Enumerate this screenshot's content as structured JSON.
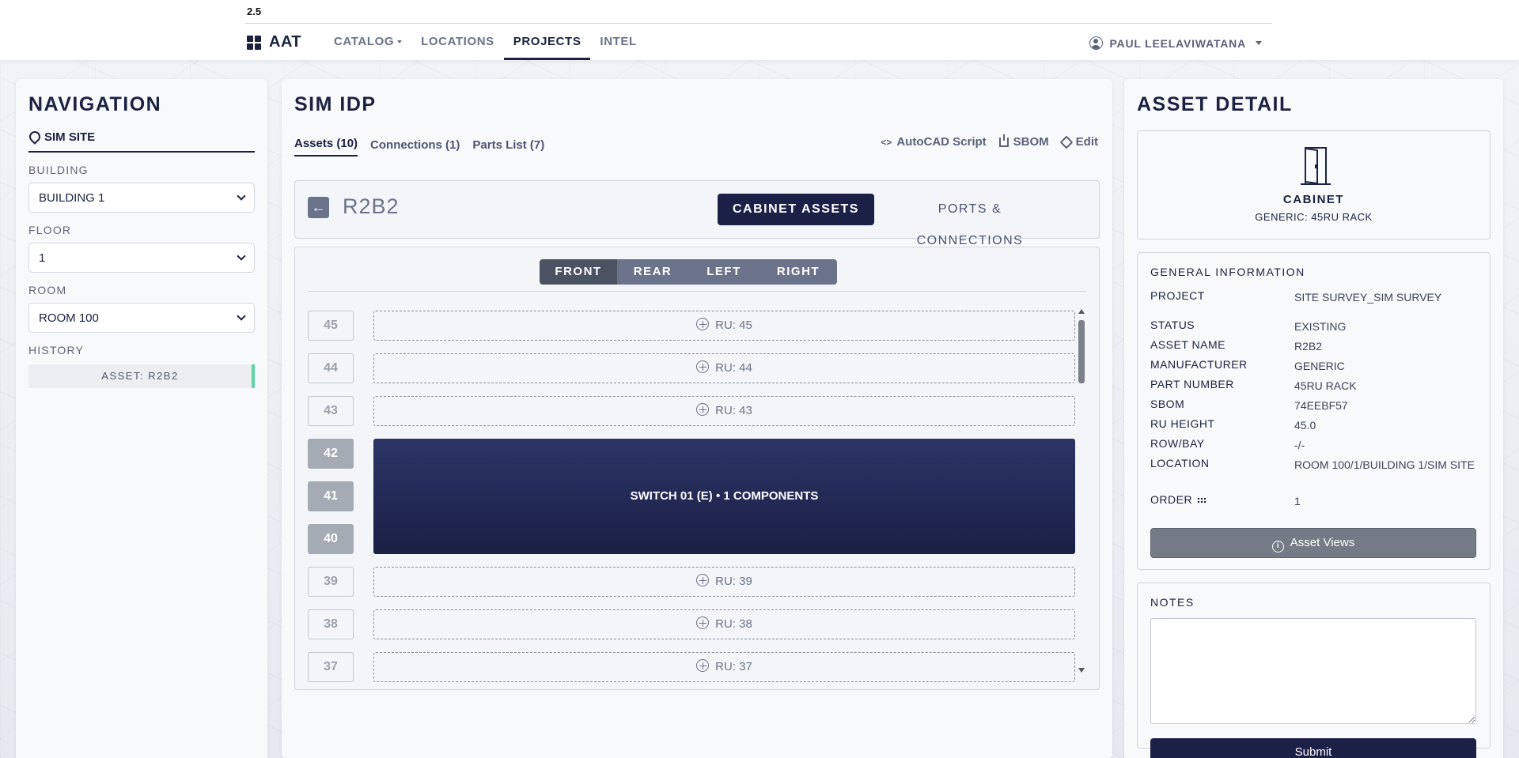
{
  "app": {
    "version": "2.5",
    "brand": "AAT",
    "nav": [
      {
        "label": "CATALOG"
      },
      {
        "label": "LOCATIONS"
      },
      {
        "label": "PROJECTS"
      },
      {
        "label": "INTEL"
      }
    ],
    "user": "PAUL LEELAVIWATANA"
  },
  "navigation": {
    "title": "NAVIGATION",
    "site": "SIM SITE",
    "building_label": "BUILDING",
    "building_value": "BUILDING 1",
    "floor_label": "FLOOR",
    "floor_value": "1",
    "room_label": "ROOM",
    "room_value": "ROOM 100",
    "history_label": "HISTORY",
    "history_item": "ASSET: R2B2"
  },
  "main": {
    "title": "SIM IDP",
    "tabs": [
      {
        "label": "Assets (10)"
      },
      {
        "label": "Connections (1)"
      },
      {
        "label": "Parts List (7)"
      }
    ],
    "actions": {
      "autocad": "AutoCAD Script",
      "sbom": "SBOM",
      "edit": "Edit"
    },
    "cabinet": {
      "back_icon": "←",
      "name": "R2B2",
      "cabinet_assets": "CABINET ASSETS",
      "ports_connections": "PORTS & CONNECTIONS"
    },
    "views": [
      "FRONT",
      "REAR",
      "LEFT",
      "RIGHT"
    ],
    "rows": [
      {
        "ru": "45",
        "label": "RU: 45"
      },
      {
        "ru": "44",
        "label": "RU: 44"
      },
      {
        "ru": "43",
        "label": "RU: 43"
      },
      {
        "ru": "42",
        "label": ""
      },
      {
        "ru": "41",
        "label": ""
      },
      {
        "ru": "40",
        "label": ""
      },
      {
        "ru": "39",
        "label": "RU: 39"
      },
      {
        "ru": "38",
        "label": "RU: 38"
      },
      {
        "ru": "37",
        "label": "RU: 37"
      }
    ],
    "device": "SWITCH 01 (E) • 1 COMPONENTS"
  },
  "detail": {
    "title": "ASSET DETAIL",
    "icon": "door-cabinet-icon",
    "type": "CABINET",
    "subtype": "GENERIC: 45RU RACK",
    "general_title": "GENERAL INFORMATION",
    "fields": [
      {
        "k": "PROJECT",
        "v": "SITE SURVEY_SIM SURVEY"
      },
      {
        "k": "STATUS",
        "v": "EXISTING"
      },
      {
        "k": "ASSET NAME",
        "v": "R2B2"
      },
      {
        "k": "MANUFACTURER",
        "v": "GENERIC"
      },
      {
        "k": "PART NUMBER",
        "v": "45RU RACK"
      },
      {
        "k": "SBOM",
        "v": "74EEBF57"
      },
      {
        "k": "RU HEIGHT",
        "v": "45.0"
      },
      {
        "k": "ROW/BAY",
        "v": "-/-"
      },
      {
        "k": "LOCATION",
        "v": "ROOM 100/1/BUILDING 1/SIM SITE"
      },
      {
        "k": "ORDER",
        "v": "1"
      }
    ],
    "asset_views": "Asset Views",
    "notes_title": "NOTES",
    "notes_value": "",
    "submit": "Submit"
  }
}
